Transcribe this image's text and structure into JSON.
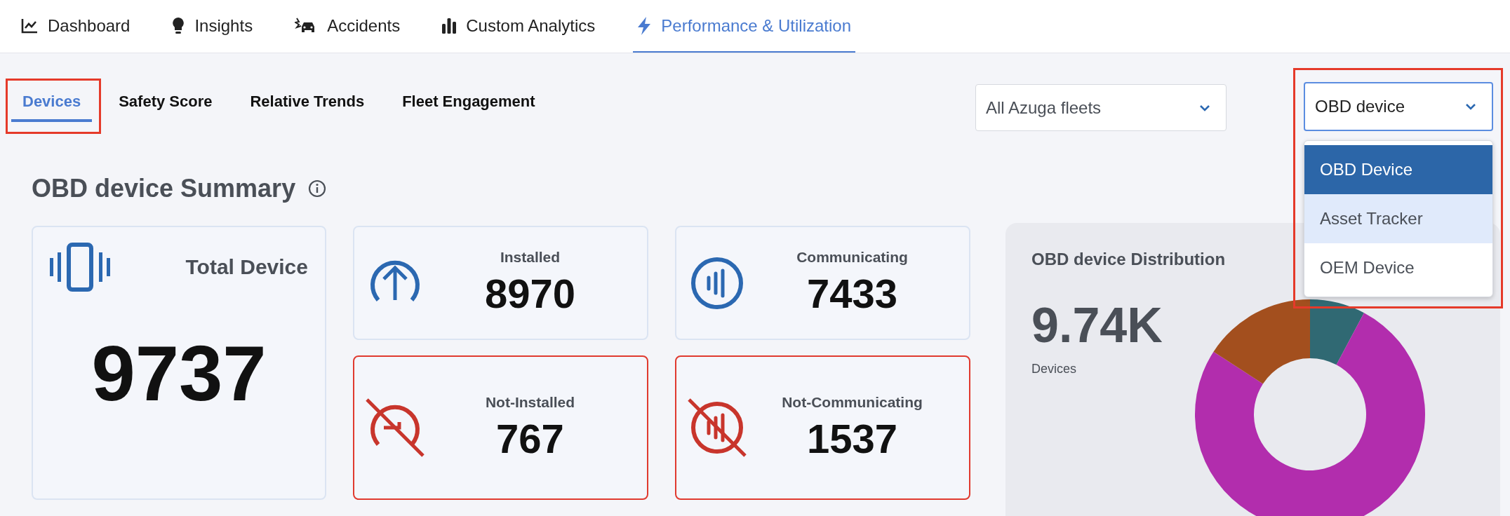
{
  "nav_tabs": [
    {
      "label": "Dashboard",
      "selected": false
    },
    {
      "label": "Insights",
      "selected": false
    },
    {
      "label": "Accidents",
      "selected": false
    },
    {
      "label": "Custom Analytics",
      "selected": false
    },
    {
      "label": "Performance & Utilization",
      "selected": true
    }
  ],
  "sub_tabs": [
    {
      "label": "Devices",
      "selected": true
    },
    {
      "label": "Safety Score",
      "selected": false
    },
    {
      "label": "Relative Trends",
      "selected": false
    },
    {
      "label": "Fleet Engagement",
      "selected": false
    }
  ],
  "fleet_select": {
    "value": "All Azuga fleets"
  },
  "device_select": {
    "value": "OBD device",
    "expanded": true,
    "options": [
      {
        "label": "OBD Device",
        "selected": true,
        "hovered": false
      },
      {
        "label": "Asset Tracker",
        "selected": false,
        "hovered": true
      },
      {
        "label": "OEM Device",
        "selected": false,
        "hovered": false
      }
    ]
  },
  "summary": {
    "title": "OBD device Summary",
    "total": {
      "label": "Total Device",
      "value": "9737"
    },
    "cards": [
      {
        "label": "Installed",
        "value": "8970",
        "alert": false
      },
      {
        "label": "Communicating",
        "value": "7433",
        "alert": false
      },
      {
        "label": "Not-Installed",
        "value": "767",
        "alert": true
      },
      {
        "label": "Not-Communicating",
        "value": "1537",
        "alert": true
      }
    ]
  },
  "distribution": {
    "title": "OBD device Distribution",
    "value": "9.74K",
    "unit": "Devices"
  }
}
